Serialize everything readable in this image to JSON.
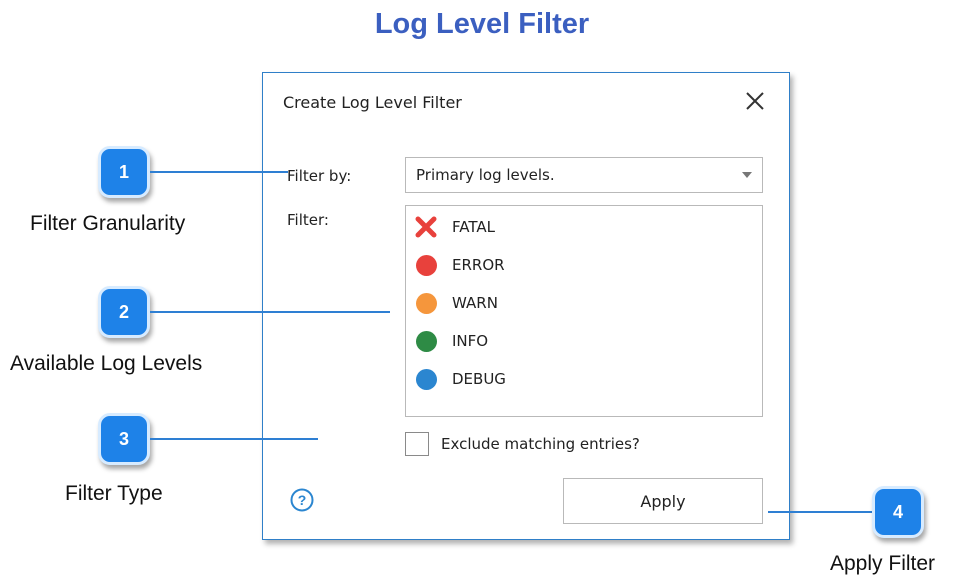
{
  "page": {
    "title": "Log Level Filter"
  },
  "dialog": {
    "title": "Create Log Level Filter",
    "filter_by_label": "Filter by:",
    "filter_by_value": "Primary log levels.",
    "filter_label": "Filter:",
    "levels": [
      {
        "label": "FATAL",
        "icon": "x-icon",
        "color": "#e8413c"
      },
      {
        "label": "ERROR",
        "icon": "dot-icon",
        "color": "#e8413c"
      },
      {
        "label": "WARN",
        "icon": "dot-icon",
        "color": "#f5963c"
      },
      {
        "label": "INFO",
        "icon": "dot-icon",
        "color": "#2e8b45"
      },
      {
        "label": "DEBUG",
        "icon": "dot-icon",
        "color": "#2b86d0"
      }
    ],
    "exclude_label": "Exclude matching entries?",
    "exclude_checked": false,
    "help_symbol": "?",
    "apply_label": "Apply"
  },
  "callouts": [
    {
      "number": "1",
      "label": "Filter Granularity"
    },
    {
      "number": "2",
      "label": "Available Log Levels"
    },
    {
      "number": "3",
      "label": "Filter Type"
    },
    {
      "number": "4",
      "label": "Apply Filter"
    }
  ],
  "colors": {
    "accent": "#1e82e8",
    "title": "#3b5fc0",
    "dialog_border": "#2f7fc8"
  }
}
